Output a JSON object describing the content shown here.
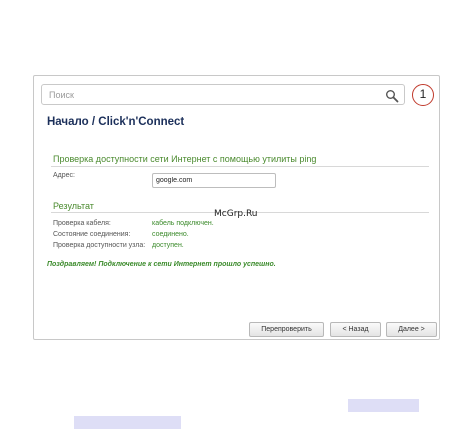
{
  "search": {
    "placeholder": "Поиск"
  },
  "callout": {
    "number": "1"
  },
  "breadcrumb": {
    "home": "Начало /",
    "current": "Click'n'Connect"
  },
  "ping_section": {
    "title": "Проверка доступности сети Интернет с помощью утилиты ping",
    "address_label": "Адрес:",
    "address_value": "google.com"
  },
  "watermark": "McGrp.Ru",
  "result_section": {
    "title": "Результат",
    "rows": [
      {
        "label": "Проверка кабеля:",
        "value": "кабель подключен."
      },
      {
        "label": "Состояние соединения:",
        "value": "соединено."
      },
      {
        "label": "Проверка доступности узла:",
        "value": "доступен."
      }
    ],
    "success_message": "Поздравляем! Подключение к сети Интернет прошло успешно."
  },
  "buttons": {
    "recheck": "Перепроверить",
    "back": "< Назад",
    "next": "Далее >"
  },
  "colors": {
    "accent_green": "#4a8a2e",
    "title_navy": "#1b2f5a",
    "callout_red": "#c0392b"
  },
  "icons": {
    "search": "magnifier-icon"
  }
}
